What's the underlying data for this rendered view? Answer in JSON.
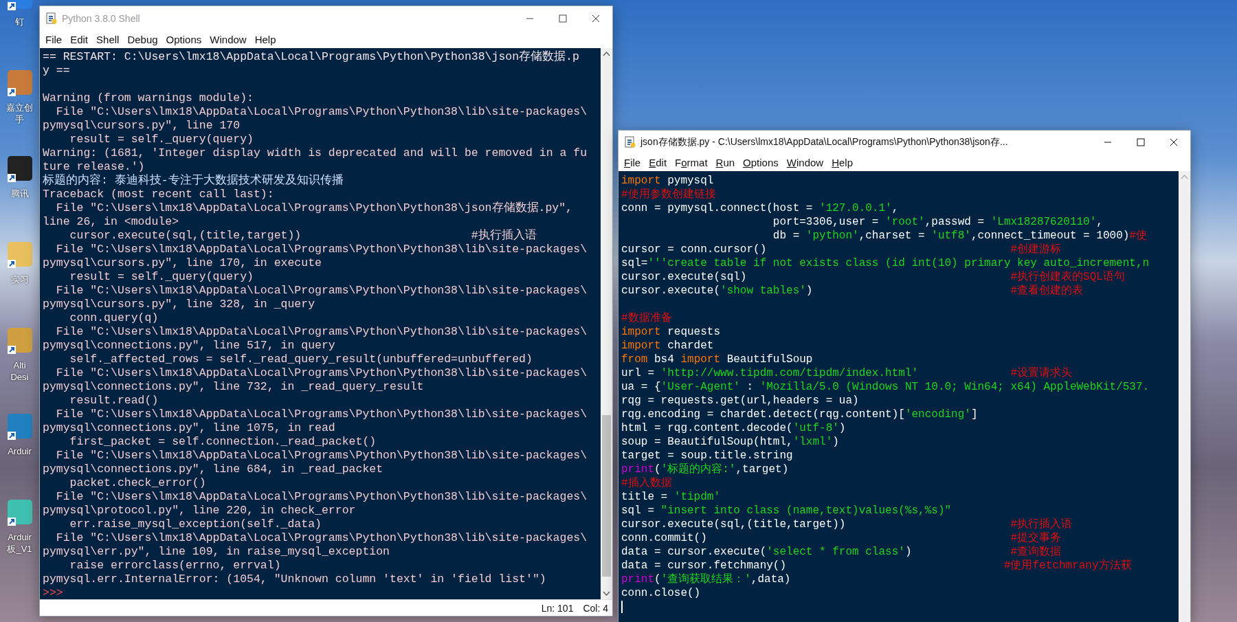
{
  "desktop_icons": [
    {
      "label": [
        "钉"
      ],
      "color": "#2a7de1"
    },
    {
      "label": [
        "嘉立创",
        "手"
      ],
      "color": "#c87a3a"
    },
    {
      "label": [
        "腾讯"
      ],
      "color": "#222222"
    },
    {
      "label": [
        "实习"
      ],
      "color": "#e8c060"
    },
    {
      "label": [
        "Alti",
        "Desi"
      ],
      "color": "#d0a040"
    },
    {
      "label": [
        "Arduir"
      ],
      "color": "#2080c0"
    },
    {
      "label": [
        "Arduir",
        "板_V1"
      ],
      "color": "#40c0b0"
    }
  ],
  "shell_window": {
    "title": "Python 3.8.0 Shell",
    "active": false,
    "menu": [
      {
        "key": "File"
      },
      {
        "key": "Edit"
      },
      {
        "key": "Shell"
      },
      {
        "key": "Debug"
      },
      {
        "key": "Options"
      },
      {
        "key": "Window"
      },
      {
        "key": "Help"
      }
    ],
    "output_blocks": [
      [
        {
          "kind": "output",
          "text": "== RESTART: C:\\Users\\lmx18\\AppData\\Local\\Programs\\Python\\Python38\\json存储数据.p"
        },
        {
          "kind": "output",
          "text": "y =="
        }
      ],
      [
        {
          "kind": "stderr",
          "text": "Warning (from warnings module):"
        },
        {
          "kind": "stderr",
          "text": "  File \"C:\\Users\\lmx18\\AppData\\Local\\Programs\\Python\\Python38\\lib\\site-packages\\"
        },
        {
          "kind": "stderr",
          "text": "pymysql\\cursors.py\", line 170"
        },
        {
          "kind": "stderr",
          "text": "    result = self._query(query)"
        },
        {
          "kind": "stderr",
          "text": "Warning: (1681, 'Integer display width is deprecated and will be removed in a fu"
        },
        {
          "kind": "stderr",
          "text": "ture release.')"
        },
        {
          "kind": "stdout",
          "text": "标题的内容: 泰迪科技-专注于大数据技术研发及知识传播"
        },
        {
          "kind": "stderr",
          "text": "Traceback (most recent call last):"
        },
        {
          "kind": "stderr",
          "text": "  File \"C:\\Users\\lmx18\\AppData\\Local\\Programs\\Python\\Python38\\json存储数据.py\","
        },
        {
          "kind": "stderr",
          "text": "line 26, in <module>"
        },
        {
          "kind": "stderr",
          "text": "    cursor.execute(sql,(title,target))                         #执行插入语"
        },
        {
          "kind": "stderr",
          "text": "  File \"C:\\Users\\lmx18\\AppData\\Local\\Programs\\Python\\Python38\\lib\\site-packages\\"
        },
        {
          "kind": "stderr",
          "text": "pymysql\\cursors.py\", line 170, in execute"
        },
        {
          "kind": "stderr",
          "text": "    result = self._query(query)"
        },
        {
          "kind": "stderr",
          "text": "  File \"C:\\Users\\lmx18\\AppData\\Local\\Programs\\Python\\Python38\\lib\\site-packages\\"
        },
        {
          "kind": "stderr",
          "text": "pymysql\\cursors.py\", line 328, in _query"
        },
        {
          "kind": "stderr",
          "text": "    conn.query(q)"
        },
        {
          "kind": "stderr",
          "text": "  File \"C:\\Users\\lmx18\\AppData\\Local\\Programs\\Python\\Python38\\lib\\site-packages\\"
        },
        {
          "kind": "stderr",
          "text": "pymysql\\connections.py\", line 517, in query"
        },
        {
          "kind": "stderr",
          "text": "    self._affected_rows = self._read_query_result(unbuffered=unbuffered)"
        },
        {
          "kind": "stderr",
          "text": "  File \"C:\\Users\\lmx18\\AppData\\Local\\Programs\\Python\\Python38\\lib\\site-packages\\"
        },
        {
          "kind": "stderr",
          "text": "pymysql\\connections.py\", line 732, in _read_query_result"
        },
        {
          "kind": "stderr",
          "text": "    result.read()"
        },
        {
          "kind": "stderr",
          "text": "  File \"C:\\Users\\lmx18\\AppData\\Local\\Programs\\Python\\Python38\\lib\\site-packages\\"
        },
        {
          "kind": "stderr",
          "text": "pymysql\\connections.py\", line 1075, in read"
        },
        {
          "kind": "stderr",
          "text": "    first_packet = self.connection._read_packet()"
        },
        {
          "kind": "stderr",
          "text": "  File \"C:\\Users\\lmx18\\AppData\\Local\\Programs\\Python\\Python38\\lib\\site-packages\\"
        },
        {
          "kind": "stderr",
          "text": "pymysql\\connections.py\", line 684, in _read_packet"
        },
        {
          "kind": "stderr",
          "text": "    packet.check_error()"
        },
        {
          "kind": "stderr",
          "text": "  File \"C:\\Users\\lmx18\\AppData\\Local\\Programs\\Python\\Python38\\lib\\site-packages\\"
        },
        {
          "kind": "stderr",
          "text": "pymysql\\protocol.py\", line 220, in check_error"
        },
        {
          "kind": "stderr",
          "text": "    err.raise_mysql_exception(self._data)"
        },
        {
          "kind": "stderr",
          "text": "  File \"C:\\Users\\lmx18\\AppData\\Local\\Programs\\Python\\Python38\\lib\\site-packages\\"
        },
        {
          "kind": "stderr",
          "text": "pymysql\\err.py\", line 109, in raise_mysql_exception"
        },
        {
          "kind": "stderr",
          "text": "    raise errorclass(errno, errval)"
        },
        {
          "kind": "stderr",
          "text": "pymysql.err.InternalError: (1054, \"Unknown column 'text' in 'field list'\")"
        },
        {
          "kind": "prompt",
          "text": ">>>"
        }
      ]
    ],
    "status_bar": {
      "line": "Ln: 101",
      "column": "Col: 4"
    }
  },
  "editor_window": {
    "title": "json存储数据.py - C:\\Users\\lmx18\\AppData\\Local\\Programs\\Python\\Python38\\json存...",
    "active": true,
    "menu": [
      {
        "key": "F",
        "rest": "ile"
      },
      {
        "key": "E",
        "rest": "dit"
      },
      {
        "lead": "F",
        "key": "o",
        "rest": "rmat"
      },
      {
        "key": "R",
        "rest": "un"
      },
      {
        "key": "O",
        "rest": "ptions"
      },
      {
        "key": "W",
        "rest": "indow"
      },
      {
        "key": "H",
        "rest": "elp"
      }
    ],
    "code_blocks": [
      [
        [
          {
            "kind": "keyword",
            "text": "import"
          },
          {
            "kind": "plain",
            "text": " pymysql"
          }
        ],
        [
          {
            "kind": "comment",
            "text": "#使用参数创建链接"
          }
        ],
        [
          {
            "kind": "plain",
            "text": "conn = pymysql.connect(host = "
          },
          {
            "kind": "string",
            "text": "'127.0.0.1'"
          },
          {
            "kind": "plain",
            "text": ","
          }
        ],
        [
          {
            "kind": "plain",
            "text": "                       port=3306,user = "
          },
          {
            "kind": "string",
            "text": "'root'"
          },
          {
            "kind": "plain",
            "text": ",passwd = "
          },
          {
            "kind": "string",
            "text": "'Lmx18287620110'"
          },
          {
            "kind": "plain",
            "text": ","
          }
        ],
        [
          {
            "kind": "plain",
            "text": "                       db = "
          },
          {
            "kind": "string",
            "text": "'python'"
          },
          {
            "kind": "plain",
            "text": ",charset = "
          },
          {
            "kind": "string",
            "text": "'utf8'"
          },
          {
            "kind": "plain",
            "text": ",connect_timeout = 1000)"
          },
          {
            "kind": "comment",
            "text": "#使"
          }
        ],
        [
          {
            "kind": "plain",
            "text": "cursor = conn.cursor()                                     "
          },
          {
            "kind": "comment",
            "text": "#创建游标"
          }
        ],
        [
          {
            "kind": "plain",
            "text": "sql="
          },
          {
            "kind": "string",
            "text": "'''create table if not exists class (id int(10) primary key auto_increment,n"
          }
        ],
        [
          {
            "kind": "plain",
            "text": "cursor.execute(sql)                                        "
          },
          {
            "kind": "comment",
            "text": "#执行创建表的SQL语句"
          }
        ],
        [
          {
            "kind": "plain",
            "text": "cursor.execute("
          },
          {
            "kind": "string",
            "text": "'show tables'"
          },
          {
            "kind": "plain",
            "text": ")                              "
          },
          {
            "kind": "comment",
            "text": "#查看创建的表"
          }
        ]
      ],
      [
        [
          {
            "kind": "comment",
            "text": "#数据准备"
          }
        ],
        [
          {
            "kind": "keyword",
            "text": "import"
          },
          {
            "kind": "plain",
            "text": " requests"
          }
        ],
        [
          {
            "kind": "keyword",
            "text": "import"
          },
          {
            "kind": "plain",
            "text": " chardet"
          }
        ],
        [
          {
            "kind": "keyword",
            "text": "from"
          },
          {
            "kind": "plain",
            "text": " bs4 "
          },
          {
            "kind": "keyword",
            "text": "import"
          },
          {
            "kind": "plain",
            "text": " BeautifulSoup"
          }
        ],
        [
          {
            "kind": "plain",
            "text": "url = "
          },
          {
            "kind": "string",
            "text": "'http://www.tipdm.com/tipdm/index.html'"
          },
          {
            "kind": "comment",
            "text": "              #设置请求头"
          }
        ],
        [
          {
            "kind": "plain",
            "text": "ua = {"
          },
          {
            "kind": "string",
            "text": "'User-Agent'"
          },
          {
            "kind": "plain",
            "text": " : "
          },
          {
            "kind": "string",
            "text": "'Mozilla/5.0 (Windows NT 10.0; Win64; x64) AppleWebKit/537."
          }
        ],
        [
          {
            "kind": "plain",
            "text": "rqg = requests.get(url,headers = ua)"
          }
        ],
        [
          {
            "kind": "plain",
            "text": "rqg.encoding = chardet.detect(rqg.content)["
          },
          {
            "kind": "string",
            "text": "'encoding'"
          },
          {
            "kind": "plain",
            "text": "]"
          }
        ],
        [
          {
            "kind": "plain",
            "text": "html = rqg.content.decode("
          },
          {
            "kind": "string",
            "text": "'utf-8'"
          },
          {
            "kind": "plain",
            "text": ")"
          }
        ],
        [
          {
            "kind": "plain",
            "text": "soup = BeautifulSoup(html,"
          },
          {
            "kind": "string",
            "text": "'lxml'"
          },
          {
            "kind": "plain",
            "text": ")"
          }
        ],
        [
          {
            "kind": "plain",
            "text": "target = soup.title.string"
          }
        ],
        [
          {
            "kind": "builtin",
            "text": "print"
          },
          {
            "kind": "plain",
            "text": "("
          },
          {
            "kind": "string",
            "text": "'标题的内容:'"
          },
          {
            "kind": "plain",
            "text": ",target)"
          }
        ],
        [
          {
            "kind": "comment",
            "text": "#插入数据"
          }
        ],
        [
          {
            "kind": "plain",
            "text": "title = "
          },
          {
            "kind": "string",
            "text": "'tipdm'"
          }
        ],
        [
          {
            "kind": "plain",
            "text": "sql = "
          },
          {
            "kind": "string",
            "text": "\"insert into class (name,text)values(%s,%s)\""
          }
        ],
        [
          {
            "kind": "plain",
            "text": "cursor.execute(sql,(title,target))                         "
          },
          {
            "kind": "comment",
            "text": "#执行插入语"
          }
        ],
        [
          {
            "kind": "plain",
            "text": "conn.commit()                                              "
          },
          {
            "kind": "comment",
            "text": "#提交事务"
          }
        ],
        [
          {
            "kind": "plain",
            "text": "data = cursor.execute("
          },
          {
            "kind": "string",
            "text": "'select * from class'"
          },
          {
            "kind": "plain",
            "text": ")               "
          },
          {
            "kind": "comment",
            "text": "#查询数据"
          }
        ],
        [
          {
            "kind": "plain",
            "text": "data = cursor.fetchmany()                                 "
          },
          {
            "kind": "comment",
            "text": "#使用fetchmrany方法获"
          }
        ],
        [
          {
            "kind": "builtin",
            "text": "print"
          },
          {
            "kind": "plain",
            "text": "("
          },
          {
            "kind": "string",
            "text": "'查询获取结果：'"
          },
          {
            "kind": "plain",
            "text": ",data)"
          }
        ],
        [
          {
            "kind": "plain",
            "text": "conn.close()"
          }
        ]
      ]
    ]
  }
}
